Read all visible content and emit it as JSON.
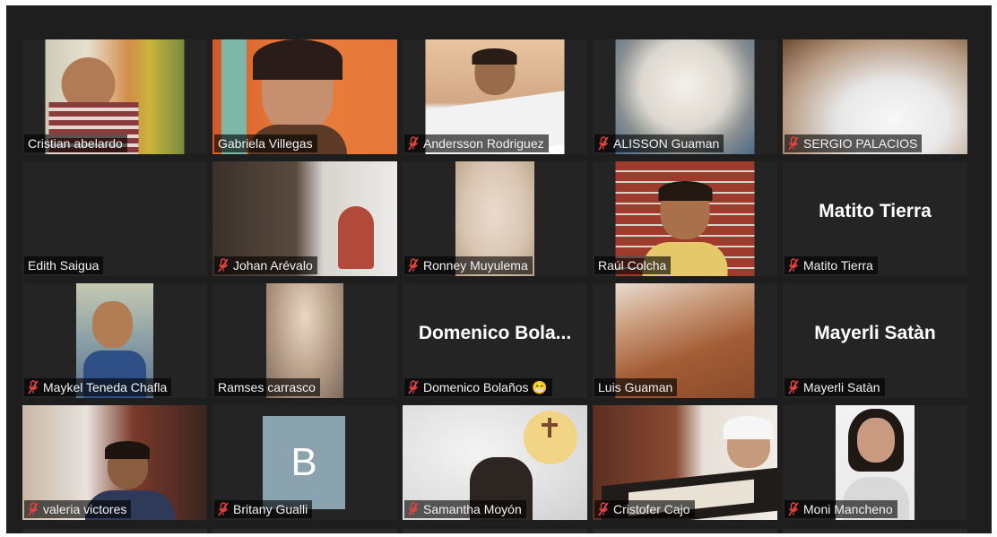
{
  "participants": [
    {
      "name": "Cristian abelardo",
      "muted": false
    },
    {
      "name": "Gabriela Villegas",
      "muted": false,
      "active_speaker": true
    },
    {
      "name": "Andersson Rodriguez",
      "muted": true
    },
    {
      "name": "ALISSON Guaman",
      "muted": true
    },
    {
      "name": "SERGIO PALACIOS",
      "muted": true
    },
    {
      "name": "Edith Saigua",
      "muted": false
    },
    {
      "name": "Johan Arévalo",
      "muted": true
    },
    {
      "name": "Ronney Muyulema",
      "muted": true
    },
    {
      "name": "Raúl Colcha",
      "muted": false
    },
    {
      "name": "Matito Tierra",
      "muted": true,
      "display_name": "Matito Tierra"
    },
    {
      "name": "Maykel Teneda Chafla",
      "muted": true
    },
    {
      "name": "Ramses carrasco",
      "muted": false
    },
    {
      "name": "Domenico Bolaños 😁",
      "muted": true,
      "display_name": "Domenico  Bola..."
    },
    {
      "name": "Luis Guaman",
      "muted": false
    },
    {
      "name": "Mayerli Satàn",
      "muted": true,
      "display_name": "Mayerli Satàn"
    },
    {
      "name": "valeria victores",
      "muted": true
    },
    {
      "name": "Britany Gualli",
      "muted": true,
      "avatar_letter": "B"
    },
    {
      "name": "Samantha Moyón",
      "muted": true
    },
    {
      "name": "Cristofer Cajo",
      "muted": true
    },
    {
      "name": "Moni Mancheno",
      "muted": true
    }
  ],
  "colors": {
    "background": "#1e1e1e",
    "tile": "#242424",
    "active_speaker_border": "#c8e832",
    "muted_icon": "#e0443e",
    "avatar_bg": "#8aa3ae"
  },
  "icons": {
    "muted": "mic-muted-icon"
  }
}
